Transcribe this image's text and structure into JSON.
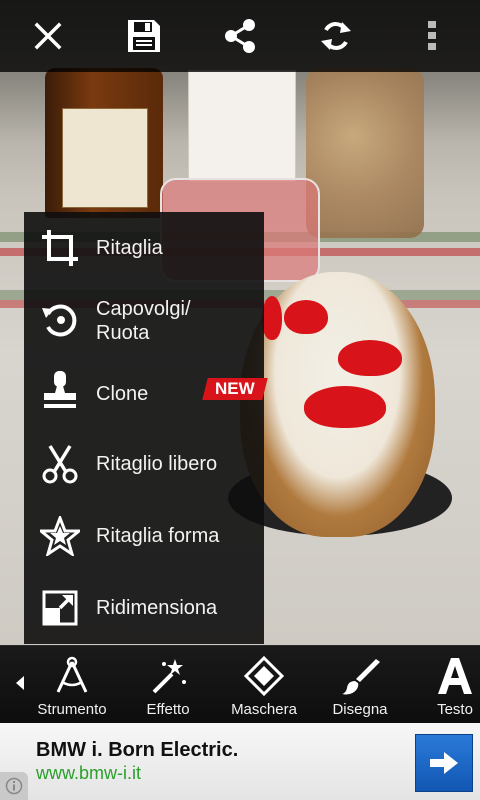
{
  "topbar": {
    "icons": [
      "close-icon",
      "save-icon",
      "share-icon",
      "refresh-icon",
      "overflow-menu-icon"
    ]
  },
  "menu": {
    "items": [
      {
        "label": "Ritaglia",
        "icon": "crop-icon"
      },
      {
        "label": "Capovolgi/\nRuota",
        "icon": "rotate-icon"
      },
      {
        "label": "Clone",
        "icon": "clone-stamp-icon"
      },
      {
        "label": "Ritaglio libero",
        "icon": "scissors-icon"
      },
      {
        "label": "Ritaglia forma",
        "icon": "star-shape-icon"
      },
      {
        "label": "Ridimensiona",
        "icon": "resize-icon"
      }
    ],
    "new_badge": "NEW"
  },
  "toolbar": {
    "tools": [
      {
        "label": "Strumento",
        "icon": "compass-tool-icon"
      },
      {
        "label": "Effetto",
        "icon": "magic-wand-icon"
      },
      {
        "label": "Maschera",
        "icon": "mask-icon"
      },
      {
        "label": "Disegna",
        "icon": "brush-icon"
      },
      {
        "label": "Testo",
        "icon": "text-icon"
      }
    ]
  },
  "ad": {
    "title": "BMW i. Born Electric.",
    "url": "www.bmw-i.it"
  },
  "colors": {
    "badge": "#d8141a",
    "ad_url": "#2aa02a",
    "ad_button": "#1257b4"
  }
}
